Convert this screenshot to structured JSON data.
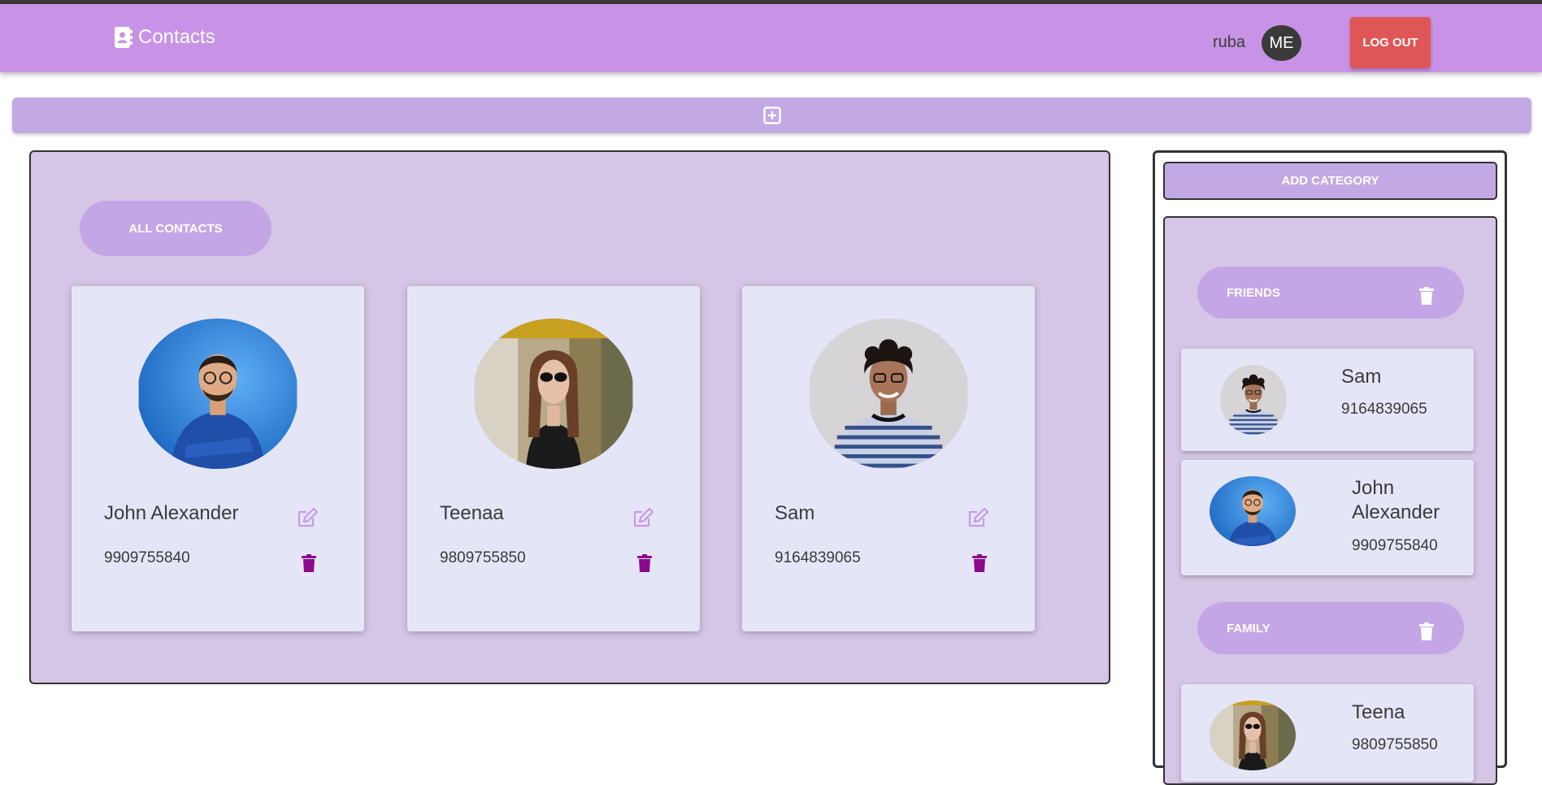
{
  "header": {
    "app_title": "Contacts",
    "brand_icon": "contact-book-icon",
    "username": "ruba",
    "avatar_initials": "ME",
    "logout_label": "LOG OUT"
  },
  "add_bar": {
    "icon": "add-box-icon"
  },
  "main": {
    "all_contacts_label": "ALL CONTACTS",
    "contacts": [
      {
        "name": "John Alexander",
        "phone": "9909755840"
      },
      {
        "name": "Teenaa",
        "phone": "9809755850"
      },
      {
        "name": "Sam",
        "phone": "9164839065"
      }
    ]
  },
  "sidebar": {
    "add_category_label": "ADD CATEGORY",
    "categories": [
      {
        "label": "FRIENDS",
        "contacts": [
          {
            "name": "Sam",
            "phone": "9164839065"
          },
          {
            "name": "John Alexander",
            "phone": "9909755840"
          }
        ]
      },
      {
        "label": "FAMILY",
        "contacts": [
          {
            "name": "Teena",
            "phone": "9809755850"
          }
        ]
      }
    ]
  },
  "colors": {
    "appbar": "#c893e6",
    "logout": "#df5656",
    "accent_purple": "#c4a6e6",
    "panel": "#d5c5e6",
    "card": "#e5e5f8",
    "trash": "#8b0a8b",
    "edit": "#c79be8"
  }
}
